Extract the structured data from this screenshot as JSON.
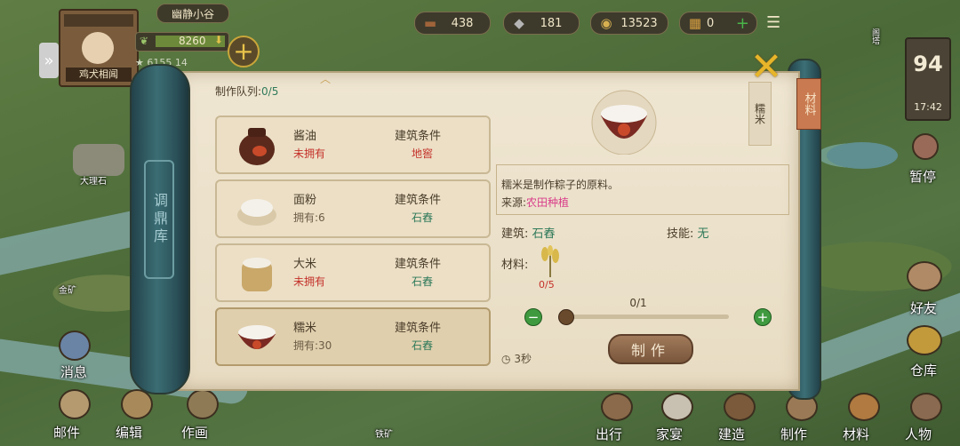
{
  "header": {
    "area_name": "幽静小谷",
    "player_title": "鸡犬相闻",
    "player_exp": "8260",
    "player_sub_left": "6155",
    "player_sub_right": "14"
  },
  "resources": [
    {
      "icon": "wood-icon",
      "value": "438"
    },
    {
      "icon": "stone-icon",
      "value": "181"
    },
    {
      "icon": "coin-icon",
      "value": "13523"
    },
    {
      "icon": "ticket-icon",
      "value": "0"
    }
  ],
  "clock": {
    "day": "94",
    "time": "17:42"
  },
  "map_labels": {
    "marble": "大理石",
    "gold_mine": "金矿",
    "iron_mine": "铁矿",
    "pavilion": "阁塔"
  },
  "scroll": {
    "spine_label": "调鼎库",
    "queue_label": "制作队列:",
    "queue_count": "0/5",
    "tab_material": "材料",
    "side_tag": "糯米"
  },
  "recipes": [
    {
      "name": "酱油",
      "ownership": "未拥有",
      "cond_label": "建筑条件",
      "building": "地窖",
      "selected": false
    },
    {
      "name": "面粉",
      "ownership": "拥有:6",
      "cond_label": "建筑条件",
      "building": "石舂",
      "selected": false
    },
    {
      "name": "大米",
      "ownership": "未拥有",
      "cond_label": "建筑条件",
      "building": "石舂",
      "selected": false
    },
    {
      "name": "糯米",
      "ownership": "拥有:30",
      "cond_label": "建筑条件",
      "building": "石舂",
      "selected": true
    }
  ],
  "detail": {
    "description": "糯米是制作粽子的原料。",
    "source_label": "来源:",
    "source_value": "农田种植",
    "building_label": "建筑:",
    "building_value": "石舂",
    "skill_label": "技能:",
    "skill_value": "无",
    "material_label": "材料:",
    "material_count": "0/5",
    "quantity": "0/1",
    "quantity_fraction": 0,
    "time": "3秒",
    "make_button": "制作"
  },
  "right_menu": [
    "暂停",
    "好友",
    "仓库"
  ],
  "left_menu": [
    "消息"
  ],
  "bottom_left": [
    "邮件",
    "编辑",
    "作画"
  ],
  "bottom_right": [
    "出行",
    "家宴",
    "建造",
    "制作",
    "材料",
    "人物"
  ],
  "colors": {
    "ok": "#2f7a5a",
    "missing": "#c4312a",
    "source": "#d93d8a",
    "plus": "#3f9a3f"
  }
}
